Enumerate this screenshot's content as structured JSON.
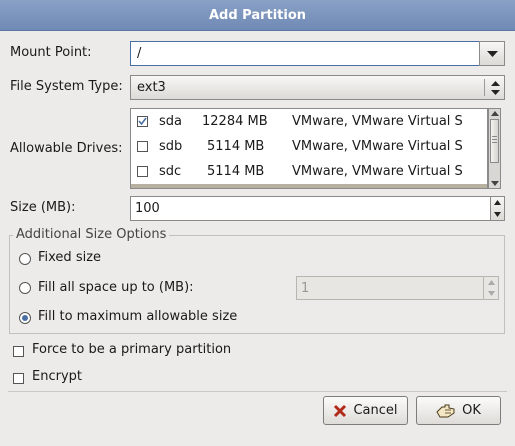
{
  "window": {
    "title": "Add Partition"
  },
  "mount_point": {
    "label": "Mount Point:",
    "value": "/"
  },
  "fs_type": {
    "label": "File System Type:",
    "value": "ext3"
  },
  "drives": {
    "label": "Allowable Drives:",
    "rows": [
      {
        "checked": true,
        "name": "sda",
        "size": "12284 MB",
        "model": "VMware, VMware Virtual S"
      },
      {
        "checked": false,
        "name": "sdb",
        "size": "5114 MB",
        "model": "VMware, VMware Virtual S"
      },
      {
        "checked": false,
        "name": "sdc",
        "size": "5114 MB",
        "model": "VMware, VMware Virtual S"
      }
    ]
  },
  "size": {
    "label": "Size (MB):",
    "value": "100"
  },
  "additional": {
    "legend": "Additional Size Options",
    "fixed_label": "Fixed size",
    "fill_upto_label": "Fill all space up to (MB):",
    "fill_upto_value": "1",
    "fill_max_label": "Fill to maximum allowable size",
    "selected": "fill_max"
  },
  "force_primary": {
    "label": "Force to be a primary partition",
    "checked": false
  },
  "encrypt": {
    "label": "Encrypt",
    "checked": false
  },
  "buttons": {
    "cancel": "Cancel",
    "ok": "OK"
  }
}
